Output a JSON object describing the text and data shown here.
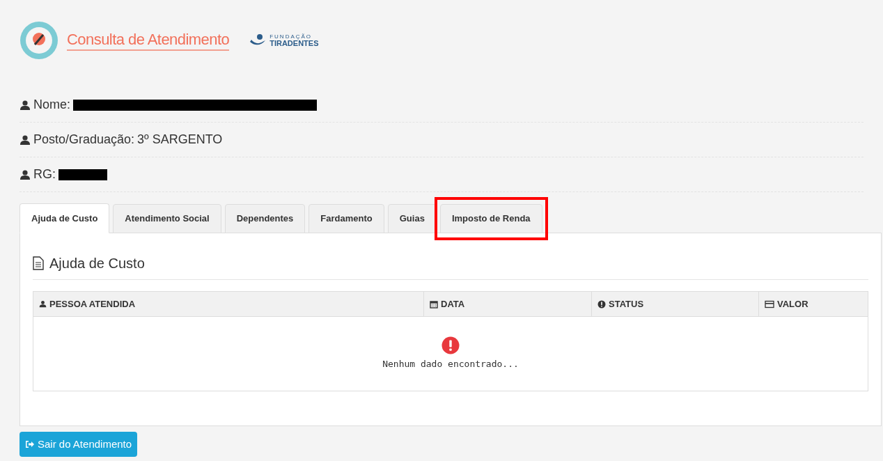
{
  "header": {
    "title": "Consulta de Atendimento",
    "partner_top": "FUNDAÇÃO",
    "partner_name": "TIRADENTES"
  },
  "info": [
    {
      "label": "Nome:",
      "redacted": true
    },
    {
      "label": "Posto/Graduação:",
      "redacted": false,
      "value": "3º SARGENTO"
    },
    {
      "label": "RG:",
      "redacted": true
    }
  ],
  "tabs": [
    {
      "label": "Ajuda de Custo",
      "selected": true,
      "highlighted": false
    },
    {
      "label": "Atendimento Social",
      "selected": false,
      "highlighted": false
    },
    {
      "label": "Dependentes",
      "selected": false,
      "highlighted": false
    },
    {
      "label": "Fardamento",
      "selected": false,
      "highlighted": false
    },
    {
      "label": "Guias",
      "selected": false,
      "highlighted": false
    },
    {
      "label": "Imposto de Renda",
      "selected": false,
      "highlighted": true
    }
  ],
  "panel": {
    "title": "Ajuda de Custo"
  },
  "table": {
    "columns": [
      {
        "label": "PESSOA ATENDIDA",
        "kind": "person"
      },
      {
        "label": "DATA",
        "kind": "calendar"
      },
      {
        "label": "STATUS",
        "kind": "alert"
      },
      {
        "label": "VALOR",
        "kind": "card"
      }
    ],
    "empty_message": "Nenhum dado encontrado..."
  },
  "exit_button": "Sair do Atendimento"
}
